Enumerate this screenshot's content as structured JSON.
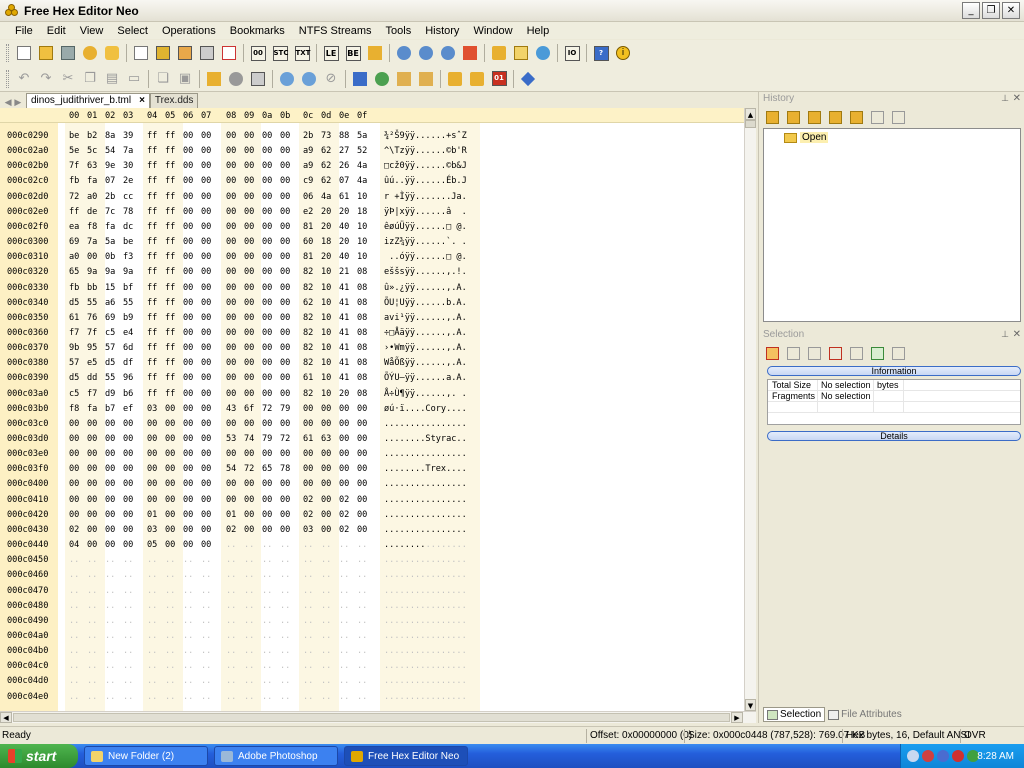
{
  "window": {
    "title": "Free Hex Editor Neo"
  },
  "menu": [
    "File",
    "Edit",
    "View",
    "Select",
    "Operations",
    "Bookmarks",
    "NTFS Streams",
    "Tools",
    "History",
    "Window",
    "Help"
  ],
  "toolbar_text": {
    "le": "LE",
    "be": "BE",
    "b01": "01"
  },
  "tabs": [
    {
      "label": "dinos_judithriver_b.tml",
      "close": "×"
    },
    {
      "label": "Trex.dds"
    }
  ],
  "hex": {
    "col_headers": [
      "00",
      "01",
      "02",
      "03",
      "04",
      "05",
      "06",
      "07",
      "08",
      "09",
      "0a",
      "0b",
      "0c",
      "0d",
      "0e",
      "0f"
    ],
    "rows": [
      {
        "addr": "000c0290",
        "bytes": [
          "be",
          "b2",
          "8a",
          "39",
          "ff",
          "ff",
          "00",
          "00",
          "00",
          "00",
          "00",
          "00",
          "2b",
          "73",
          "88",
          "5a"
        ],
        "ascii": "¾²Š9ÿÿ......+sˆZ"
      },
      {
        "addr": "000c02a0",
        "bytes": [
          "5e",
          "5c",
          "54",
          "7a",
          "ff",
          "ff",
          "00",
          "00",
          "00",
          "00",
          "00",
          "00",
          "a9",
          "62",
          "27",
          "52"
        ],
        "ascii": "^\\Tzÿÿ......©b'R"
      },
      {
        "addr": "000c02b0",
        "bytes": [
          "7f",
          "63",
          "9e",
          "30",
          "ff",
          "ff",
          "00",
          "00",
          "00",
          "00",
          "00",
          "00",
          "a9",
          "62",
          "26",
          "4a"
        ],
        "ascii": "□cž0ÿÿ......©b&J"
      },
      {
        "addr": "000c02c0",
        "bytes": [
          "fb",
          "fa",
          "07",
          "2e",
          "ff",
          "ff",
          "00",
          "00",
          "00",
          "00",
          "00",
          "00",
          "c9",
          "62",
          "07",
          "4a"
        ],
        "ascii": "ûú..ÿÿ......Éb.J"
      },
      {
        "addr": "000c02d0",
        "bytes": [
          "72",
          "a0",
          "2b",
          "cc",
          "ff",
          "ff",
          "00",
          "00",
          "00",
          "00",
          "00",
          "00",
          "06",
          "4a",
          "61",
          "10"
        ],
        "ascii": "r +Ìÿÿ.......Ja."
      },
      {
        "addr": "000c02e0",
        "bytes": [
          "ff",
          "de",
          "7c",
          "78",
          "ff",
          "ff",
          "00",
          "00",
          "00",
          "00",
          "00",
          "00",
          "e2",
          "20",
          "20",
          "18"
        ],
        "ascii": "ÿÞ|xÿÿ......â  ."
      },
      {
        "addr": "000c02f0",
        "bytes": [
          "ea",
          "f8",
          "fa",
          "dc",
          "ff",
          "ff",
          "00",
          "00",
          "00",
          "00",
          "00",
          "00",
          "81",
          "20",
          "40",
          "10"
        ],
        "ascii": "êøúÜÿÿ......□ @."
      },
      {
        "addr": "000c0300",
        "bytes": [
          "69",
          "7a",
          "5a",
          "be",
          "ff",
          "ff",
          "00",
          "00",
          "00",
          "00",
          "00",
          "00",
          "60",
          "18",
          "20",
          "10"
        ],
        "ascii": "izZ¾ÿÿ......`. ."
      },
      {
        "addr": "000c0310",
        "bytes": [
          "a0",
          "00",
          "0b",
          "f3",
          "ff",
          "ff",
          "00",
          "00",
          "00",
          "00",
          "00",
          "00",
          "81",
          "20",
          "40",
          "10"
        ],
        "ascii": " ..óÿÿ......□ @."
      },
      {
        "addr": "000c0320",
        "bytes": [
          "65",
          "9a",
          "9a",
          "9a",
          "ff",
          "ff",
          "00",
          "00",
          "00",
          "00",
          "00",
          "00",
          "82",
          "10",
          "21",
          "08"
        ],
        "ascii": "eššsÿÿ......‚.!."
      },
      {
        "addr": "000c0330",
        "bytes": [
          "fb",
          "bb",
          "15",
          "bf",
          "ff",
          "ff",
          "00",
          "00",
          "00",
          "00",
          "00",
          "00",
          "82",
          "10",
          "41",
          "08"
        ],
        "ascii": "û».¿ÿÿ......‚.A."
      },
      {
        "addr": "000c0340",
        "bytes": [
          "d5",
          "55",
          "a6",
          "55",
          "ff",
          "ff",
          "00",
          "00",
          "00",
          "00",
          "00",
          "00",
          "62",
          "10",
          "41",
          "08"
        ],
        "ascii": "ÕU¦Uÿÿ......b.A."
      },
      {
        "addr": "000c0350",
        "bytes": [
          "61",
          "76",
          "69",
          "b9",
          "ff",
          "ff",
          "00",
          "00",
          "00",
          "00",
          "00",
          "00",
          "82",
          "10",
          "41",
          "08"
        ],
        "ascii": "avi¹ÿÿ......‚.A."
      },
      {
        "addr": "000c0360",
        "bytes": [
          "f7",
          "7f",
          "c5",
          "e4",
          "ff",
          "ff",
          "00",
          "00",
          "00",
          "00",
          "00",
          "00",
          "82",
          "10",
          "41",
          "08"
        ],
        "ascii": "÷□Åäÿÿ......‚.A."
      },
      {
        "addr": "000c0370",
        "bytes": [
          "9b",
          "95",
          "57",
          "6d",
          "ff",
          "ff",
          "00",
          "00",
          "00",
          "00",
          "00",
          "00",
          "82",
          "10",
          "41",
          "08"
        ],
        "ascii": "›•Wmÿÿ......‚.A."
      },
      {
        "addr": "000c0380",
        "bytes": [
          "57",
          "e5",
          "d5",
          "df",
          "ff",
          "ff",
          "00",
          "00",
          "00",
          "00",
          "00",
          "00",
          "82",
          "10",
          "41",
          "08"
        ],
        "ascii": "WåÕßÿÿ......‚.A."
      },
      {
        "addr": "000c0390",
        "bytes": [
          "d5",
          "dd",
          "55",
          "96",
          "ff",
          "ff",
          "00",
          "00",
          "00",
          "00",
          "00",
          "00",
          "61",
          "10",
          "41",
          "08"
        ],
        "ascii": "ÕÝU–ÿÿ......a.A."
      },
      {
        "addr": "000c03a0",
        "bytes": [
          "c5",
          "f7",
          "d9",
          "b6",
          "ff",
          "ff",
          "00",
          "00",
          "00",
          "00",
          "00",
          "00",
          "82",
          "10",
          "20",
          "08"
        ],
        "ascii": "Å÷Ù¶ÿÿ......‚. ."
      },
      {
        "addr": "000c03b0",
        "bytes": [
          "f8",
          "fa",
          "b7",
          "ef",
          "03",
          "00",
          "00",
          "00",
          "43",
          "6f",
          "72",
          "79",
          "00",
          "00",
          "00",
          "00"
        ],
        "ascii": "øú·ï....Cory...."
      },
      {
        "addr": "000c03c0",
        "bytes": [
          "00",
          "00",
          "00",
          "00",
          "00",
          "00",
          "00",
          "00",
          "00",
          "00",
          "00",
          "00",
          "00",
          "00",
          "00",
          "00"
        ],
        "ascii": "................"
      },
      {
        "addr": "000c03d0",
        "bytes": [
          "00",
          "00",
          "00",
          "00",
          "00",
          "00",
          "00",
          "00",
          "53",
          "74",
          "79",
          "72",
          "61",
          "63",
          "00",
          "00"
        ],
        "ascii": "........Styrac.."
      },
      {
        "addr": "000c03e0",
        "bytes": [
          "00",
          "00",
          "00",
          "00",
          "00",
          "00",
          "00",
          "00",
          "00",
          "00",
          "00",
          "00",
          "00",
          "00",
          "00",
          "00"
        ],
        "ascii": "................"
      },
      {
        "addr": "000c03f0",
        "bytes": [
          "00",
          "00",
          "00",
          "00",
          "00",
          "00",
          "00",
          "00",
          "54",
          "72",
          "65",
          "78",
          "00",
          "00",
          "00",
          "00"
        ],
        "ascii": "........Trex...."
      },
      {
        "addr": "000c0400",
        "bytes": [
          "00",
          "00",
          "00",
          "00",
          "00",
          "00",
          "00",
          "00",
          "00",
          "00",
          "00",
          "00",
          "00",
          "00",
          "00",
          "00"
        ],
        "ascii": "................"
      },
      {
        "addr": "000c0410",
        "bytes": [
          "00",
          "00",
          "00",
          "00",
          "00",
          "00",
          "00",
          "00",
          "00",
          "00",
          "00",
          "00",
          "02",
          "00",
          "02",
          "00"
        ],
        "ascii": "................"
      },
      {
        "addr": "000c0420",
        "bytes": [
          "00",
          "00",
          "00",
          "00",
          "01",
          "00",
          "00",
          "00",
          "01",
          "00",
          "00",
          "00",
          "02",
          "00",
          "02",
          "00"
        ],
        "ascii": "................"
      },
      {
        "addr": "000c0430",
        "bytes": [
          "02",
          "00",
          "00",
          "00",
          "03",
          "00",
          "00",
          "00",
          "02",
          "00",
          "00",
          "00",
          "03",
          "00",
          "02",
          "00"
        ],
        "ascii": "................"
      },
      {
        "addr": "000c0440",
        "bytes": [
          "04",
          "00",
          "00",
          "00",
          "05",
          "00",
          "00",
          "00",
          "..",
          "..",
          "..",
          "..",
          "..",
          "..",
          "..",
          ".."
        ],
        "ascii": "........",
        "ascii_faint": "........"
      },
      {
        "addr": "000c0450",
        "faint": true
      },
      {
        "addr": "000c0460",
        "faint": true
      },
      {
        "addr": "000c0470",
        "faint": true
      },
      {
        "addr": "000c0480",
        "faint": true
      },
      {
        "addr": "000c0490",
        "faint": true
      },
      {
        "addr": "000c04a0",
        "faint": true
      },
      {
        "addr": "000c04b0",
        "faint": true
      },
      {
        "addr": "000c04c0",
        "faint": true
      },
      {
        "addr": "000c04d0",
        "faint": true
      },
      {
        "addr": "000c04e0",
        "faint": true
      }
    ],
    "faint_bytes": "..",
    "faint_ascii": "................"
  },
  "history_pane": {
    "title": "History",
    "items": [
      "Open"
    ]
  },
  "selection_pane": {
    "title": "Selection",
    "information_label": "Information",
    "details_label": "Details",
    "rows": [
      {
        "name": "Total Size",
        "value": "No selection",
        "unit": "bytes"
      },
      {
        "name": "Fragments",
        "value": "No selection",
        "unit": ""
      }
    ]
  },
  "bottom_tabs": [
    "Selection",
    "File Attributes"
  ],
  "status": {
    "ready": "Ready",
    "offset": "Offset: 0x00000000 (0)",
    "size": "Size: 0x000c0448 (787,528): 769.07 KB",
    "mode": "Hex bytes, 16, Default ANSI",
    "ovr": "OVR"
  },
  "taskbar": {
    "start": "start",
    "tasks": [
      "New Folder (2)",
      "Adobe Photoshop",
      "Free Hex Editor Neo"
    ],
    "clock": "8:28 AM"
  },
  "colors": {
    "header_bg": "#fdf2c7",
    "stripe_bg": "#fcf7e3",
    "taskbar_blue": "#245edb",
    "start_green": "#2d8a2d"
  }
}
